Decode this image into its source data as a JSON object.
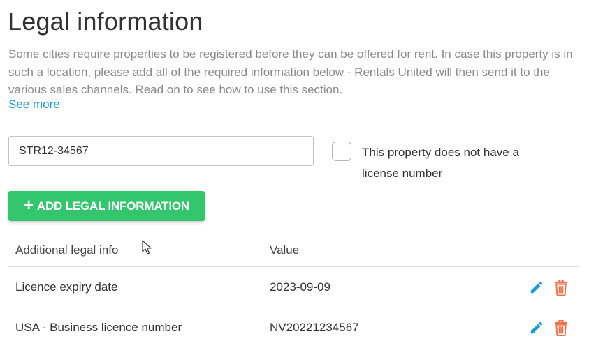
{
  "page": {
    "title": "Legal information",
    "description": "Some cities require properties to be registered before they can be offered for rent. In case this property is in such a location, please add all of the required information below - Rentals United will then send it to the various sales channels. Read on to see how to use this section.",
    "see_more": "See more"
  },
  "license": {
    "value": "STR12-34567",
    "no_license_label": "This property does not have a license number",
    "no_license_checked": false
  },
  "add_button": {
    "plus": "+",
    "label": "ADD LEGAL INFORMATION"
  },
  "table": {
    "headers": [
      "Additional legal info",
      "Value"
    ],
    "rows": [
      {
        "info": "Licence expiry date",
        "value": "2023-09-09"
      },
      {
        "info": "USA - Business licence number",
        "value": "NV20221234567"
      }
    ]
  },
  "icons": {
    "edit": "pencil-icon",
    "delete": "trash-icon",
    "cursor": "mouse-cursor-icon"
  },
  "colors": {
    "link": "#1a9dd8",
    "primary_button": "#33c66c",
    "edit_icon": "#1a9dd8",
    "delete_icon": "#f2704a",
    "muted_text": "#8a8a8a"
  }
}
